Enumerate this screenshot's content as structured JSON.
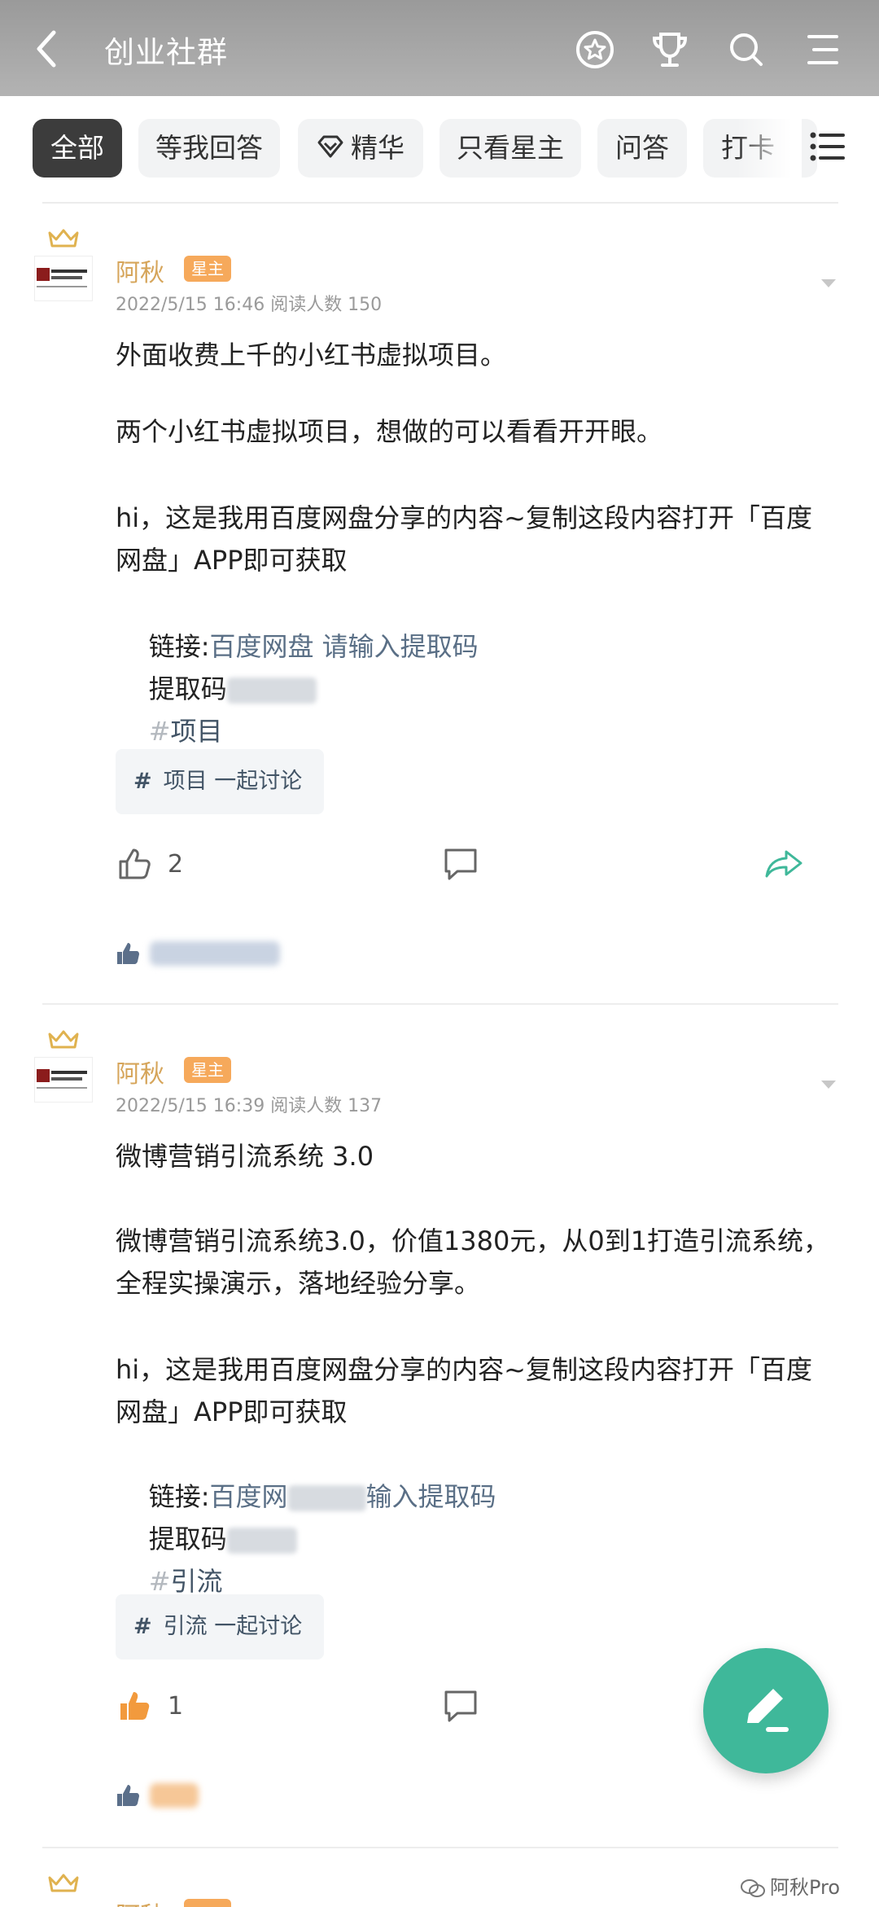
{
  "header": {
    "title": "创业社群"
  },
  "tabs": [
    {
      "label": "全部",
      "active": true
    },
    {
      "label": "等我回答"
    },
    {
      "label": "精华"
    },
    {
      "label": "只看星主"
    },
    {
      "label": "问答"
    },
    {
      "label": "打卡"
    }
  ],
  "posts": [
    {
      "author": "阿秋",
      "badge": "星主",
      "meta": "2022/5/15 16:46  阅读人数 150",
      "line1": "外面收费上千的小红书虚拟项目。",
      "line2": "两个小红书虚拟项目，想做的可以看看开开眼。",
      "line3": "hi，这是我用百度网盘分享的内容~复制这段内容打开「百度网盘」APP即可获取",
      "link_prefix": "链接:",
      "link_text": "百度网盘 请输入提取码",
      "code_label": "提取码",
      "hashtag": "项目",
      "topic": "项目 一起讨论",
      "likes": "2"
    },
    {
      "author": "阿秋",
      "badge": "星主",
      "meta": "2022/5/15 16:39  阅读人数 137",
      "line1": "微博营销引流系统 3.0",
      "line2": "微博营销引流系统3.0，价值1380元，从0到1打造引流系统，全程实操演示，落地经验分享。",
      "line3": "hi，这是我用百度网盘分享的内容~复制这段内容打开「百度网盘」APP即可获取",
      "link_prefix": "链接:",
      "link_text_a": "百度网",
      "link_text_b": "输入提取码",
      "code_label": "提取码",
      "hashtag": "引流",
      "topic": "引流 一起讨论",
      "likes": "1"
    }
  ],
  "third_post_author": "阿秋",
  "watermark": "阿秋Pro",
  "colors": {
    "header": "#a9a9a9",
    "accent": "#3fb89a",
    "author": "#d6a55a",
    "badge": "#f6a95b",
    "link": "#5a6f86"
  }
}
